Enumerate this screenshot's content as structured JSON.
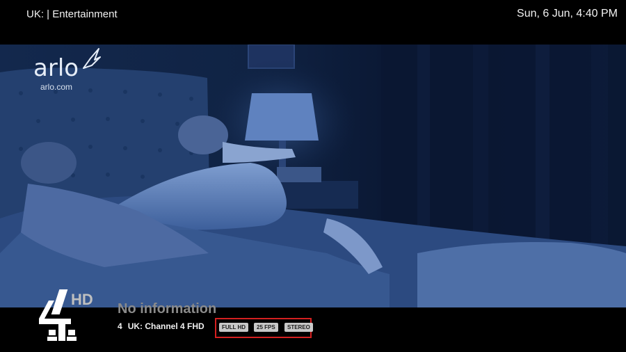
{
  "topbar": {
    "group_title": "UK: | Entertainment",
    "clock": "Sun, 6 Jun, 4:40 PM"
  },
  "video": {
    "ad_brand": "arlo",
    "ad_url": "arlo.com"
  },
  "channel": {
    "logo_text": "HD",
    "now_title": "No information",
    "number": "4",
    "name": "UK: Channel 4 FHD"
  },
  "badges": [
    "FULL HD",
    "25 FPS",
    "STEREO"
  ],
  "colors": {
    "badge_highlight_border": "#d42020",
    "badge_background": "#c8c8c8",
    "title_gray": "#8a8a8a"
  }
}
